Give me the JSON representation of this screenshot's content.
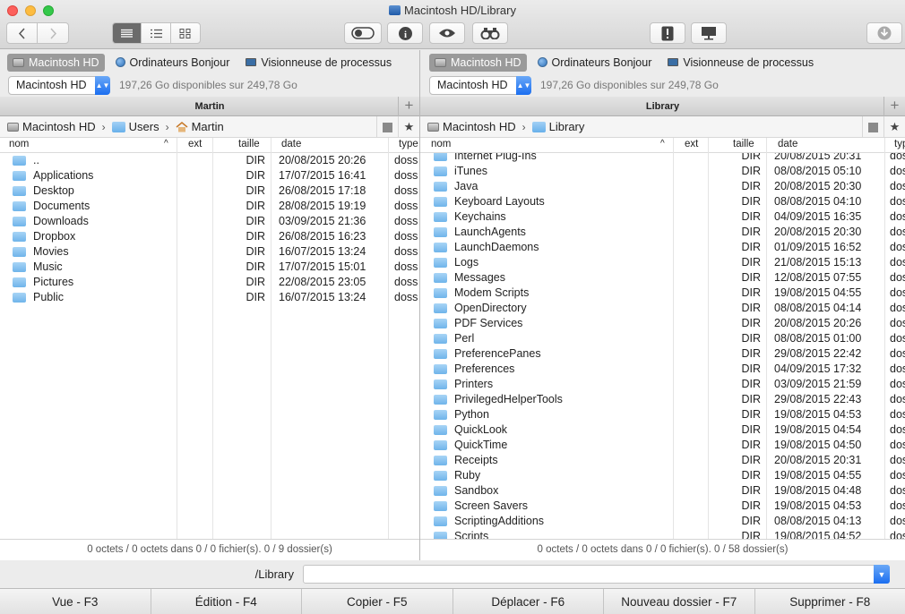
{
  "window": {
    "title": "Macintosh HD/Library"
  },
  "favorites": [
    {
      "label": "Macintosh HD",
      "icon": "drive-icon"
    },
    {
      "label": "Ordinateurs Bonjour",
      "icon": "globe-icon"
    },
    {
      "label": "Visionneuse de processus",
      "icon": "monitor-icon"
    }
  ],
  "left": {
    "drive": "Macintosh HD",
    "free": "197,26 Go disponibles sur 249,78 Go",
    "header": "Martin",
    "path": [
      "Macintosh HD",
      "Users",
      "Martin"
    ],
    "columns": {
      "name": "nom",
      "sort": "^",
      "ext": "ext",
      "size": "taille",
      "date": "date",
      "type": "type"
    },
    "rows": [
      {
        "name": "..",
        "size": "DIR",
        "date": "20/08/2015 20:26",
        "type": "doss"
      },
      {
        "name": "Applications",
        "size": "DIR",
        "date": "17/07/2015 16:41",
        "type": "doss"
      },
      {
        "name": "Desktop",
        "size": "DIR",
        "date": "26/08/2015 17:18",
        "type": "doss"
      },
      {
        "name": "Documents",
        "size": "DIR",
        "date": "28/08/2015 19:19",
        "type": "doss"
      },
      {
        "name": "Downloads",
        "size": "DIR",
        "date": "03/09/2015 21:36",
        "type": "doss"
      },
      {
        "name": "Dropbox",
        "size": "DIR",
        "date": "26/08/2015 16:23",
        "type": "doss"
      },
      {
        "name": "Movies",
        "size": "DIR",
        "date": "16/07/2015 13:24",
        "type": "doss"
      },
      {
        "name": "Music",
        "size": "DIR",
        "date": "17/07/2015 15:01",
        "type": "doss"
      },
      {
        "name": "Pictures",
        "size": "DIR",
        "date": "22/08/2015 23:05",
        "type": "doss"
      },
      {
        "name": "Public",
        "size": "DIR",
        "date": "16/07/2015 13:24",
        "type": "doss"
      }
    ],
    "status": "0 octets / 0 octets dans 0 / 0 fichier(s). 0 / 9 dossier(s)"
  },
  "right": {
    "drive": "Macintosh HD",
    "free": "197,26 Go disponibles sur 249,78 Go",
    "header": "Library",
    "path": [
      "Macintosh HD",
      "Library"
    ],
    "columns": {
      "name": "nom",
      "sort": "^",
      "ext": "ext",
      "size": "taille",
      "date": "date",
      "type": "typ"
    },
    "rows": [
      {
        "name": "Internet Plug-Ins",
        "size": "DIR",
        "date": "20/08/2015 20:31",
        "type": "dos"
      },
      {
        "name": "iTunes",
        "size": "DIR",
        "date": "08/08/2015 05:10",
        "type": "dos"
      },
      {
        "name": "Java",
        "size": "DIR",
        "date": "20/08/2015 20:30",
        "type": "dos"
      },
      {
        "name": "Keyboard Layouts",
        "size": "DIR",
        "date": "08/08/2015 04:10",
        "type": "dos"
      },
      {
        "name": "Keychains",
        "size": "DIR",
        "date": "04/09/2015 16:35",
        "type": "dos"
      },
      {
        "name": "LaunchAgents",
        "size": "DIR",
        "date": "20/08/2015 20:30",
        "type": "dos"
      },
      {
        "name": "LaunchDaemons",
        "size": "DIR",
        "date": "01/09/2015 16:52",
        "type": "dos"
      },
      {
        "name": "Logs",
        "size": "DIR",
        "date": "21/08/2015 15:13",
        "type": "dos"
      },
      {
        "name": "Messages",
        "size": "DIR",
        "date": "12/08/2015 07:55",
        "type": "dos"
      },
      {
        "name": "Modem Scripts",
        "size": "DIR",
        "date": "19/08/2015 04:55",
        "type": "dos"
      },
      {
        "name": "OpenDirectory",
        "size": "DIR",
        "date": "08/08/2015 04:14",
        "type": "dos"
      },
      {
        "name": "PDF Services",
        "size": "DIR",
        "date": "20/08/2015 20:26",
        "type": "dos"
      },
      {
        "name": "Perl",
        "size": "DIR",
        "date": "08/08/2015 01:00",
        "type": "dos"
      },
      {
        "name": "PreferencePanes",
        "size": "DIR",
        "date": "29/08/2015 22:42",
        "type": "dos"
      },
      {
        "name": "Preferences",
        "size": "DIR",
        "date": "04/09/2015 17:32",
        "type": "dos"
      },
      {
        "name": "Printers",
        "size": "DIR",
        "date": "03/09/2015 21:59",
        "type": "dos"
      },
      {
        "name": "PrivilegedHelperTools",
        "size": "DIR",
        "date": "29/08/2015 22:43",
        "type": "dos"
      },
      {
        "name": "Python",
        "size": "DIR",
        "date": "19/08/2015 04:53",
        "type": "dos"
      },
      {
        "name": "QuickLook",
        "size": "DIR",
        "date": "19/08/2015 04:54",
        "type": "dos"
      },
      {
        "name": "QuickTime",
        "size": "DIR",
        "date": "19/08/2015 04:50",
        "type": "dos"
      },
      {
        "name": "Receipts",
        "size": "DIR",
        "date": "20/08/2015 20:31",
        "type": "dos"
      },
      {
        "name": "Ruby",
        "size": "DIR",
        "date": "19/08/2015 04:55",
        "type": "dos"
      },
      {
        "name": "Sandbox",
        "size": "DIR",
        "date": "19/08/2015 04:48",
        "type": "dos"
      },
      {
        "name": "Screen Savers",
        "size": "DIR",
        "date": "19/08/2015 04:53",
        "type": "dos"
      },
      {
        "name": "ScriptingAdditions",
        "size": "DIR",
        "date": "08/08/2015 04:13",
        "type": "dos"
      },
      {
        "name": "Scripts",
        "size": "DIR",
        "date": "19/08/2015 04:52",
        "type": "dos"
      }
    ],
    "status": "0 octets / 0 octets dans 0 / 0 fichier(s). 0 / 58 dossier(s)"
  },
  "command": {
    "label": "/Library",
    "value": ""
  },
  "fkeys": [
    "Vue - F3",
    "Édition - F4",
    "Copier - F5",
    "Déplacer - F6",
    "Nouveau dossier - F7",
    "Supprimer - F8"
  ],
  "colors": {
    "accent": "#1b6ef0",
    "folder": "#6fb4ea",
    "selected_fav": "#9a9a9a"
  }
}
